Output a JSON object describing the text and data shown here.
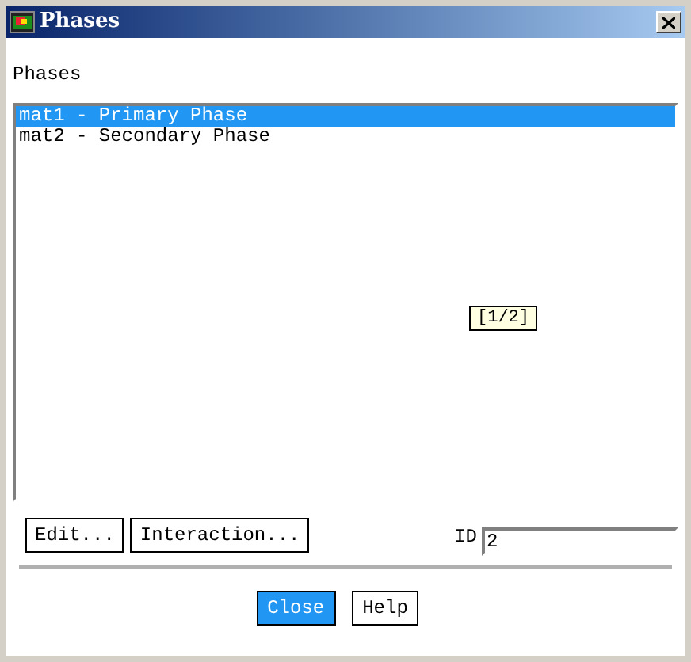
{
  "window": {
    "title": "Phases"
  },
  "list_label": "Phases",
  "phases": [
    {
      "label": "mat1 - Primary Phase",
      "selected": true
    },
    {
      "label": "mat2 - Secondary Phase",
      "selected": false
    }
  ],
  "tooltip": "[1/2]",
  "actions": [
    "Edit...",
    "Interaction..."
  ],
  "id_field": {
    "label": "ID",
    "value": "2"
  },
  "buttons": [
    {
      "label": "Close",
      "selected": true
    },
    {
      "label": "Help",
      "selected": false
    }
  ]
}
